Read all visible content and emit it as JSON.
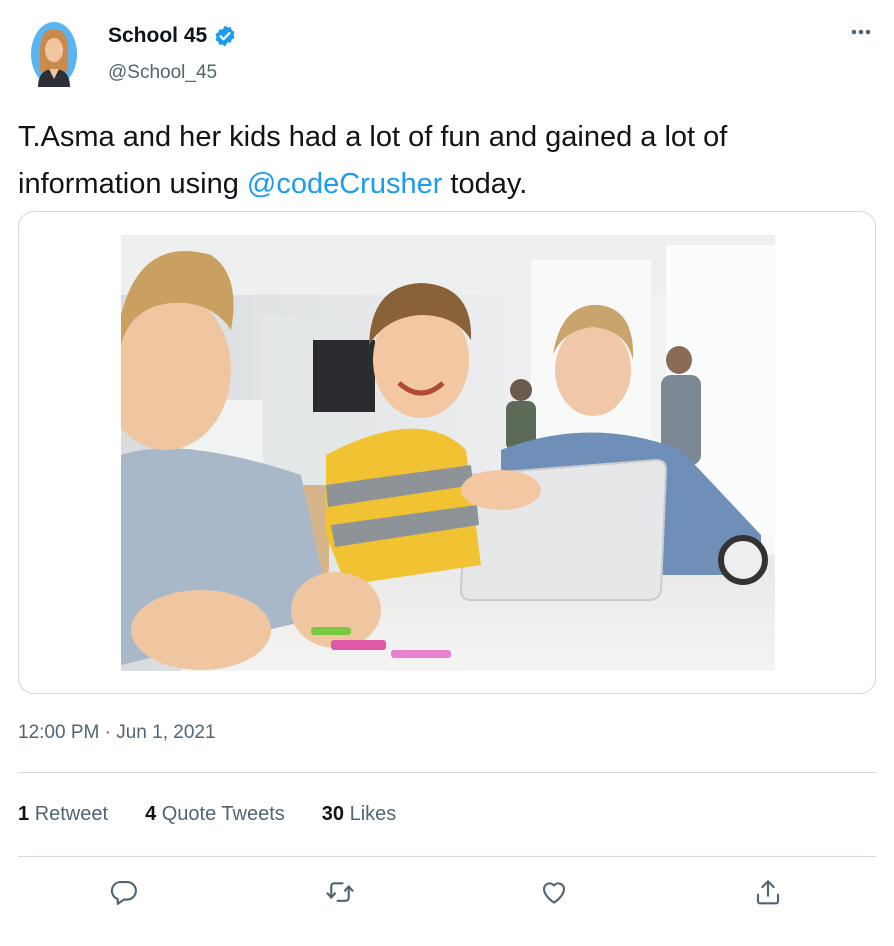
{
  "author": {
    "name": "School 45",
    "handle": "@School_45",
    "verified": true,
    "avatar_icon": "woman-avatar-icon"
  },
  "more_icon": "more-horizontal-icon",
  "tweet": {
    "text_before": "T.Asma and her kids had a lot of fun and gained a lot of information using ",
    "mention": "@codeCrusher",
    "text_after": " today."
  },
  "media": {
    "icon": "photo-kids-with-tablet"
  },
  "timestamp": "12:00 PM · Jun 1, 2021",
  "stats": {
    "retweets_count": "1",
    "retweets_label": "Retweet",
    "quotes_count": "4",
    "quotes_label": "Quote Tweets",
    "likes_count": "30",
    "likes_label": "Likes"
  },
  "actions": [
    {
      "icon": "reply-icon"
    },
    {
      "icon": "retweet-icon"
    },
    {
      "icon": "like-icon"
    },
    {
      "icon": "share-icon"
    }
  ],
  "colors": {
    "accent": "#1d9bf0",
    "text": "#0f1419",
    "secondary": "#536471",
    "border": "#cfd9de"
  }
}
